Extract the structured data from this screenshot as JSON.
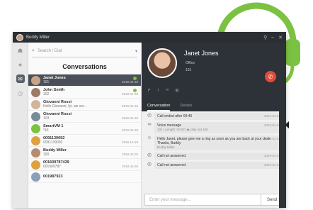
{
  "window": {
    "user_name": "Buddy Miller"
  },
  "search": {
    "placeholder": "Search / Dial"
  },
  "list_title": "Conversations",
  "conversations": [
    {
      "name": "Janet Jones",
      "sub": "101",
      "date": "2019-01-28"
    },
    {
      "name": "John Smith",
      "sub": "102",
      "date": "2019-01-28"
    },
    {
      "name": "Giovanni Rossi",
      "sub": "Hello Giovanni, fyi, we wo...",
      "date": "2019-01-28"
    },
    {
      "name": "Giovanni Rossi",
      "sub": "103",
      "date": "2019-01-28"
    },
    {
      "name": "SmartVM 1",
      "sub": "*43",
      "date": "2019-01-28"
    },
    {
      "name": "0091139092",
      "sub": "0091139092",
      "date": "2019-12-19"
    },
    {
      "name": "Buddy Miller",
      "sub": "100",
      "date": "2019-11-03"
    },
    {
      "name": "001609787439",
      "sub": "001609787",
      "date": "2019-11-03"
    },
    {
      "name": "001987923",
      "sub": "",
      "date": ""
    }
  ],
  "contact": {
    "name": "Janet Jones",
    "status": "Office",
    "ext": "101"
  },
  "tabs": [
    "Conversation",
    "Details"
  ],
  "messages": [
    {
      "icon": "phone",
      "text": "Call ended after 00:40",
      "time": "2019-01-28",
      "sub": ""
    },
    {
      "icon": "voicemail",
      "text": "Voice message",
      "time": "2019-01-28",
      "sub": "101 | Length: 00:02 | ▶ play out 100"
    },
    {
      "icon": "avatar",
      "text": "Hello Janet, please give me a ring as soon as you are back at your desk. Thanks, Buddy",
      "time": "2019-01-28",
      "sub": "Buddy Miller"
    },
    {
      "icon": "phone",
      "text": "Call not answered",
      "time": "2019-01-28",
      "sub": ""
    },
    {
      "icon": "phone",
      "text": "Call not answered",
      "time": "2019-01-28",
      "sub": ""
    }
  ],
  "composer": {
    "placeholder": "Enter your message...",
    "send": "Send"
  },
  "colors": {
    "accent_green": "#7cc242",
    "hangup_red": "#e14b3b",
    "dark": "#2d3238"
  }
}
